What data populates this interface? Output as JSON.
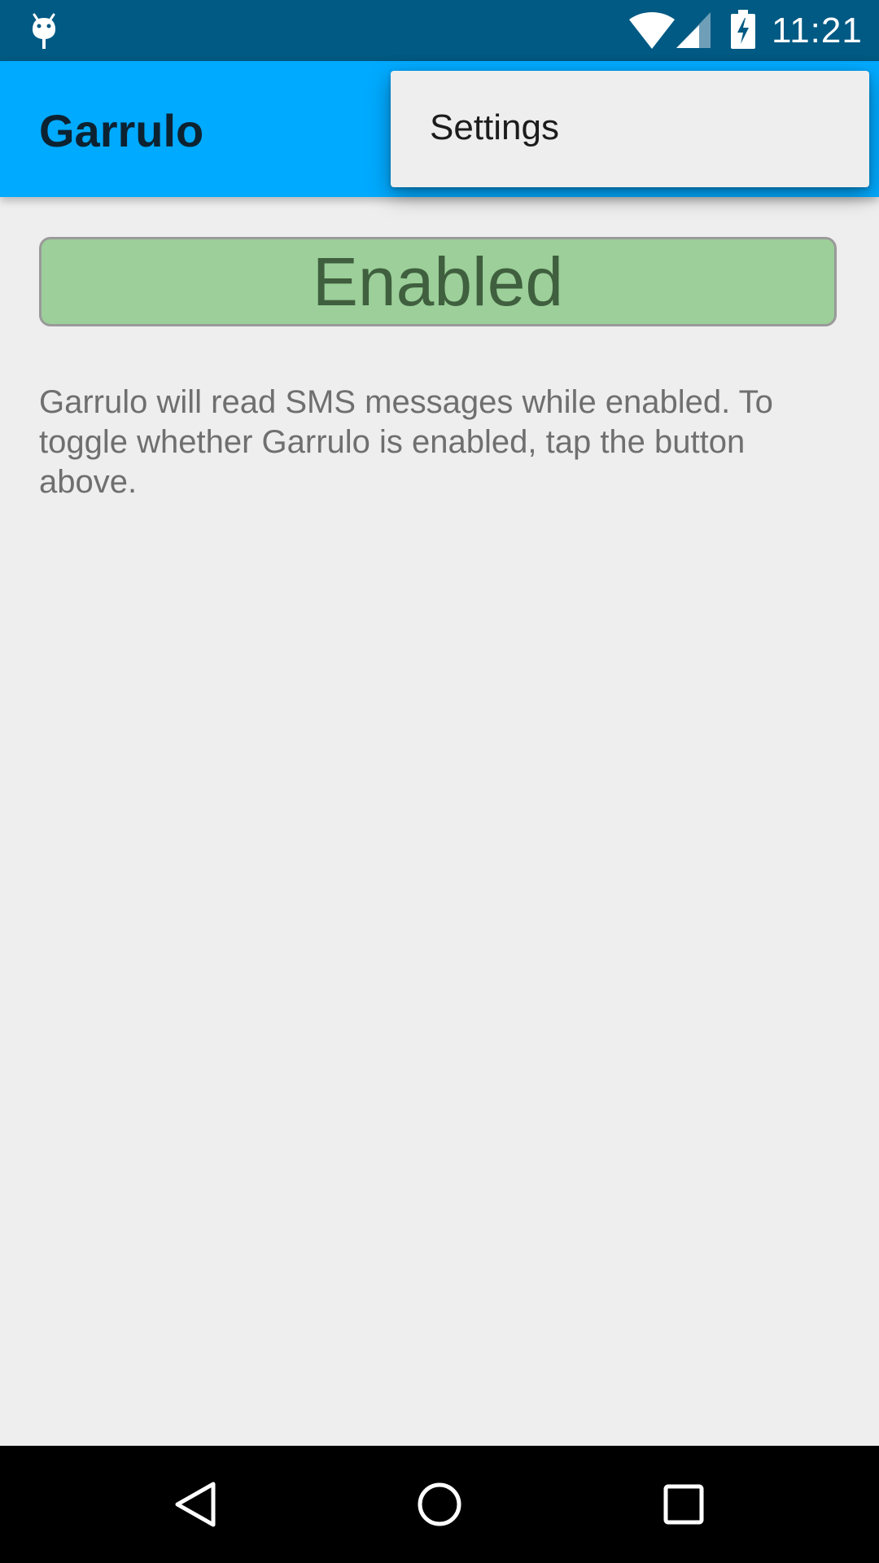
{
  "status_bar": {
    "time": "11:21",
    "icons": [
      "android-debug-icon",
      "wifi-icon",
      "cell-signal-icon",
      "battery-charging-icon"
    ]
  },
  "app_bar": {
    "title": "Garrulo",
    "color": "#00aaff"
  },
  "overflow_menu": {
    "items": [
      {
        "label": "Settings"
      }
    ]
  },
  "toggle": {
    "label": "Enabled",
    "state": "enabled",
    "color": "#9ccf99"
  },
  "description": {
    "text": "Garrulo will read SMS messages while enabled. To toggle whether Garrulo is enabled, tap the button above."
  },
  "nav_bar": {
    "buttons": [
      "back-icon",
      "home-icon",
      "recents-icon"
    ]
  },
  "colors": {
    "status_bar": "#005a83",
    "app_bar": "#00aaff",
    "background": "#eeeeee",
    "toggle_enabled": "#9ccf99"
  }
}
